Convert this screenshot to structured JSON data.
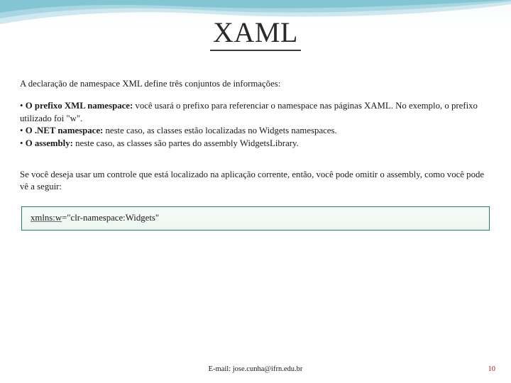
{
  "title": "XAML",
  "intro": "A declaração de namespace XML define três conjuntos de informações:",
  "bullets": [
    {
      "lead": "O prefixo XML namespace:",
      "rest": " você usará o prefixo para referenciar o namespace nas páginas XAML. No exemplo, o prefixo utilizado foi \"w\"."
    },
    {
      "lead": "O .NET namespace:",
      "rest": " neste caso, as classes estão localizadas no Widgets namespaces."
    },
    {
      "lead": "O assembly:",
      "rest": " neste caso, as classes são partes do assembly WidgetsLibrary."
    }
  ],
  "note": "Se você deseja usar um controle que está localizado na aplicação corrente, então, você pode omitir o assembly, como você pode vê a seguir:",
  "code": {
    "label": "xmlns:w",
    "value": "=\"clr-namespace:Widgets\""
  },
  "footer": {
    "email": "E-mail: jose.cunha@ifrn.edu.br",
    "page": "10"
  },
  "colors": {
    "accent_border": "#2a7a60",
    "pagenum": "#9a1f1f"
  }
}
